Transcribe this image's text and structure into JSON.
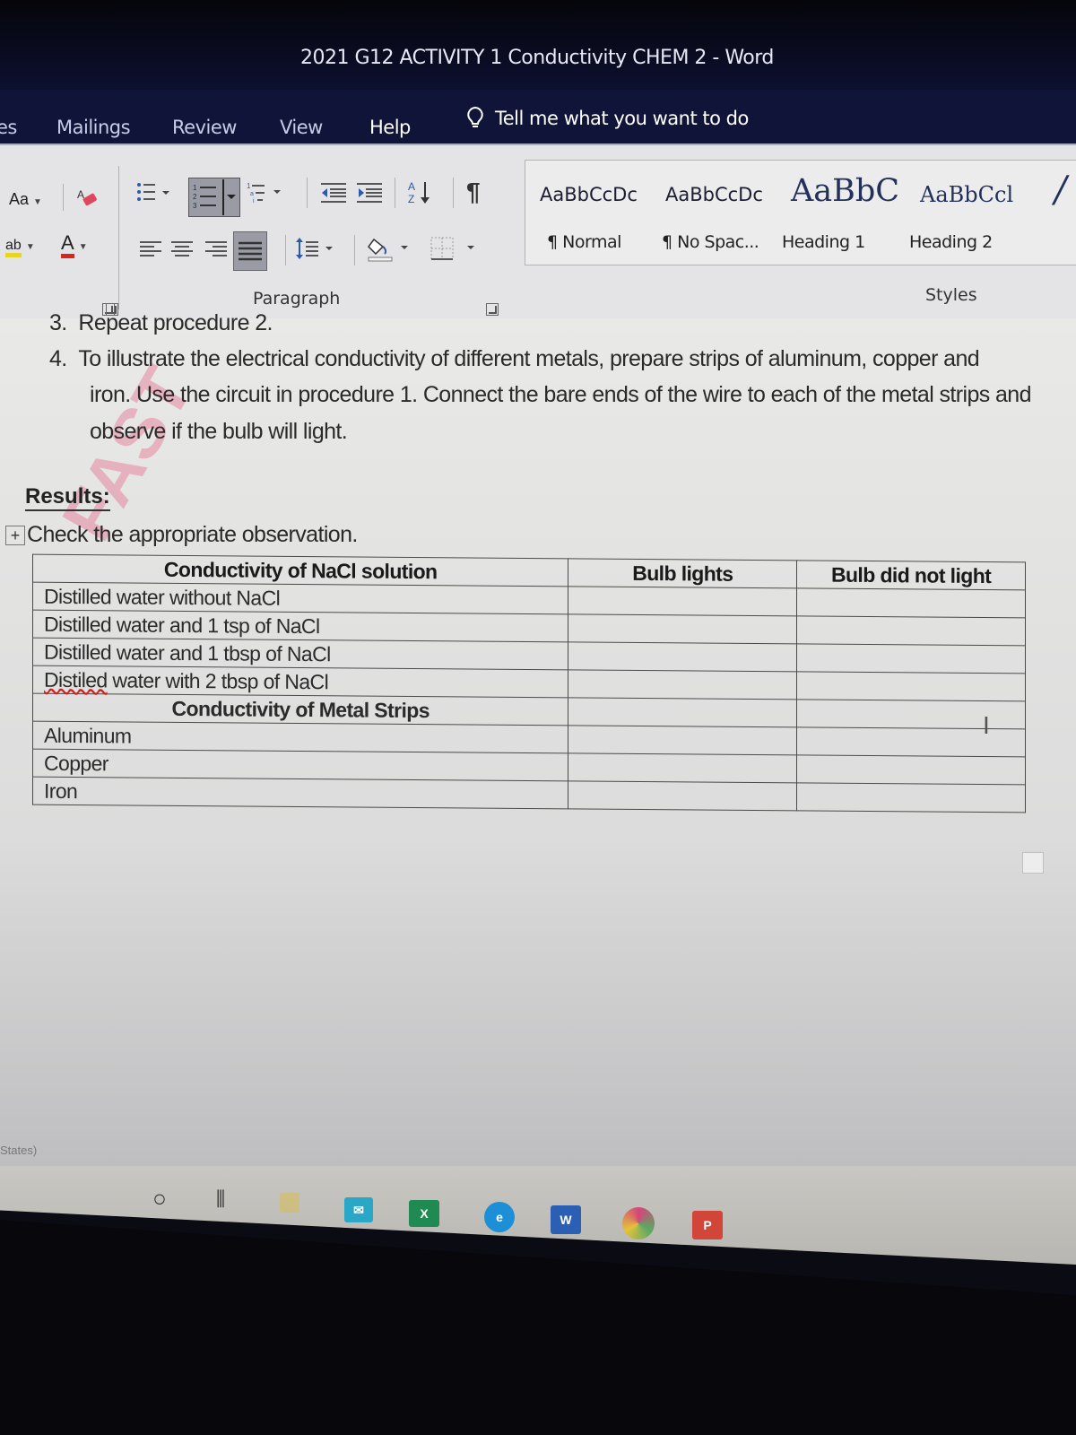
{
  "window": {
    "title": "2021 G12 ACTIVITY 1 Conductivity CHEM 2  -  Word"
  },
  "ribbon_tabs": [
    {
      "label": "es"
    },
    {
      "label": "Mailings"
    },
    {
      "label": "Review"
    },
    {
      "label": "View"
    },
    {
      "label": "Help"
    }
  ],
  "tell_me": {
    "label": "Tell me what you want to do",
    "icon": "lightbulb-icon"
  },
  "font_group": {
    "change_case": "Aa",
    "highlight": "ab",
    "font_color": "A",
    "colors": {
      "highlight": "#e8d422",
      "font_color": "#d8261c",
      "eraser": "#e0465e"
    }
  },
  "paragraph_group": {
    "label": "Paragraph",
    "buttons": [
      "bullets",
      "numbering",
      "multilevel-list",
      "decrease-indent",
      "increase-indent",
      "sort",
      "show-hide-marks",
      "align-left",
      "center",
      "align-right",
      "justify",
      "line-spacing",
      "shading",
      "borders"
    ],
    "sort_glyph": "A Z",
    "pilcrow": "¶",
    "active": [
      "numbering",
      "justify"
    ]
  },
  "styles_group": {
    "label": "Styles",
    "styles": [
      {
        "preview": "AaBbCcDc",
        "name": "¶ Normal"
      },
      {
        "preview": "AaBbCcDc",
        "name": "¶ No Spac..."
      },
      {
        "preview": "AaBbC",
        "name": "Heading 1"
      },
      {
        "preview": "AaBbCcl",
        "name": "Heading 2"
      }
    ]
  },
  "document": {
    "procedures": [
      {
        "num": "3.",
        "text": "Repeat procedure 2."
      },
      {
        "num": "4.",
        "lines": [
          "To illustrate the electrical conductivity of different metals, prepare strips of aluminum, copper and",
          "iron. Use the circuit in procedure 1. Connect the bare ends of the wire to each of the metal strips and",
          "observe if the bulb will light."
        ]
      }
    ],
    "watermark": "FAST",
    "results_heading": "Results:",
    "instruction": "Check the appropriate observation.",
    "table": {
      "headers": [
        "Conductivity of NaCl solution",
        "Bulb lights",
        "Bulb did not light"
      ],
      "nacl_rows": [
        "Distilled water without NaCl",
        "Distilled water and 1 tsp of NaCl",
        "Distilled water and 1 tbsp of NaCl",
        "Distiled water with 2 tbsp of NaCl"
      ],
      "metal_section": "Conductivity of Metal Strips",
      "metal_rows": [
        "Aluminum",
        "Copper",
        "Iron"
      ]
    }
  },
  "status_bar": {
    "language": "States)"
  },
  "taskbar": {
    "items": [
      {
        "name": "search",
        "glyph": "○"
      },
      {
        "name": "task-view",
        "glyph": "⫼"
      },
      {
        "name": "file-explorer",
        "glyph": "",
        "color": "#e3c33a"
      },
      {
        "name": "mail",
        "glyph": "✉",
        "color": "#2aa6c6"
      },
      {
        "name": "excel",
        "glyph": "X",
        "color": "#1f8a52"
      },
      {
        "name": "edge",
        "glyph": "e",
        "color": "#1d8fd6"
      },
      {
        "name": "word",
        "glyph": "W",
        "color": "#2b5fb4"
      },
      {
        "name": "chrome",
        "glyph": "",
        "color": "#d6457a"
      },
      {
        "name": "powerpoint",
        "glyph": "P",
        "color": "#d2463a"
      }
    ]
  }
}
